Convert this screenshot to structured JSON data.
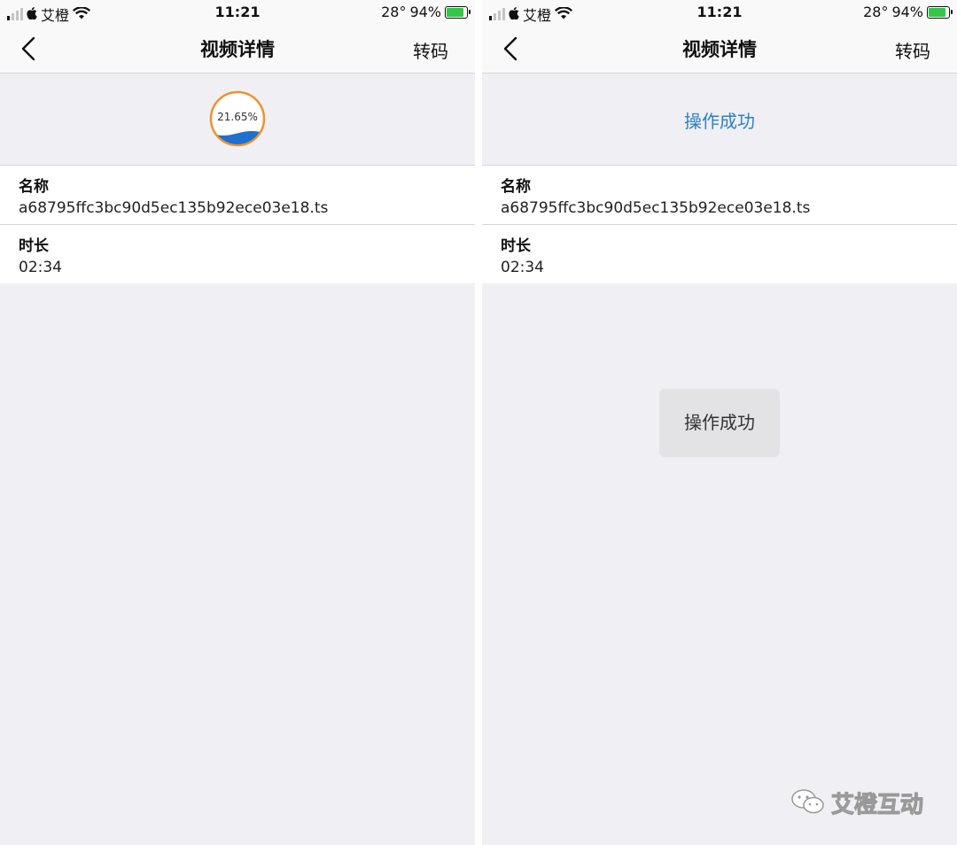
{
  "status": {
    "carrier": "艾橙",
    "time": "11:21",
    "temperature": "28°",
    "battery": "94%",
    "battery_level": 0.94,
    "battery_color": "#33c748"
  },
  "screens": [
    {
      "nav": {
        "title": "视频详情",
        "action": "转码",
        "back_icon": "chevron-left-icon"
      },
      "progress": {
        "percent_text": "21.65%",
        "fraction": 0.2165,
        "ring_color": "#f0922c",
        "fill_color": "#1f6fce"
      },
      "fields": [
        {
          "label": "名称",
          "value": "a68795ffc3bc90d5ec135b92ece03e18.ts"
        },
        {
          "label": "时长",
          "value": "02:34"
        }
      ]
    },
    {
      "nav": {
        "title": "视频详情",
        "action": "转码",
        "back_icon": "chevron-left-icon"
      },
      "success_text": "操作成功",
      "fields": [
        {
          "label": "名称",
          "value": "a68795ffc3bc90d5ec135b92ece03e18.ts"
        },
        {
          "label": "时长",
          "value": "02:34"
        }
      ],
      "toast": "操作成功"
    }
  ],
  "watermark": {
    "text": "艾橙互动",
    "icon": "wechat-icon"
  }
}
